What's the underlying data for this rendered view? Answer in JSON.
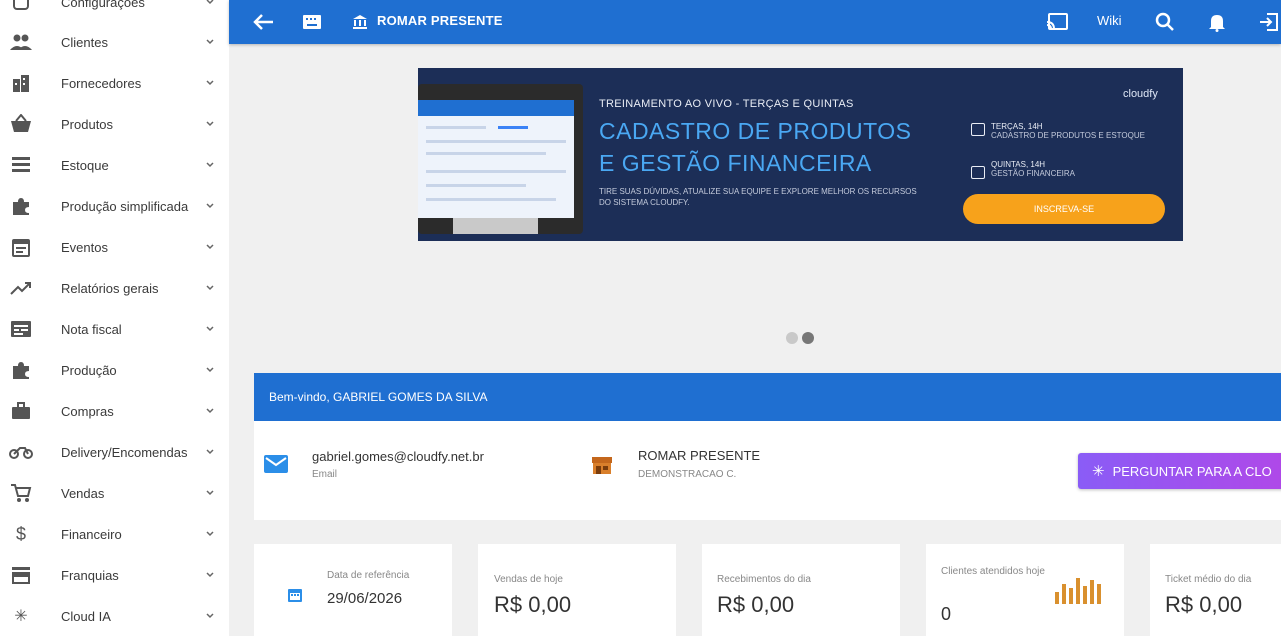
{
  "sidebar": {
    "items": [
      {
        "label": "Configurações",
        "icon": "gear-icon"
      },
      {
        "label": "Clientes",
        "icon": "people-icon"
      },
      {
        "label": "Fornecedores",
        "icon": "building-icon"
      },
      {
        "label": "Produtos",
        "icon": "basket-icon"
      },
      {
        "label": "Estoque",
        "icon": "list-icon"
      },
      {
        "label": "Produção simplificada",
        "icon": "puzzle-icon"
      },
      {
        "label": "Eventos",
        "icon": "calendar-icon"
      },
      {
        "label": "Relatórios gerais",
        "icon": "trending-icon"
      },
      {
        "label": "Nota fiscal",
        "icon": "receipt-icon"
      },
      {
        "label": "Produção",
        "icon": "puzzle-icon"
      },
      {
        "label": "Compras",
        "icon": "briefcase-icon"
      },
      {
        "label": "Delivery/Encomendas",
        "icon": "bike-icon"
      },
      {
        "label": "Vendas",
        "icon": "cart-icon"
      },
      {
        "label": "Financeiro",
        "icon": "dollar-icon"
      },
      {
        "label": "Franquias",
        "icon": "store-icon"
      },
      {
        "label": "Cloud IA",
        "icon": "sparkle-icon"
      }
    ]
  },
  "topbar": {
    "store_name": "ROMAR PRESENTE",
    "wiki_label": "Wiki"
  },
  "banner": {
    "small_title": "TREINAMENTO AO VIVO - TERÇAS E QUINTAS",
    "big_line1": "CADASTRO DE PRODUTOS",
    "big_line2": "E GESTÃO FINANCEIRA",
    "description": "TIRE SUAS DÚVIDAS, ATUALIZE SUA EQUIPE E EXPLORE MELHOR OS RECURSOS DO SISTEMA CLOUDFY.",
    "logo": "cloudfy",
    "schedule1_day": "TERÇAS, 14H",
    "schedule1_topic": "CADASTRO DE PRODUTOS E ESTOQUE",
    "schedule2_day": "QUINTAS, 14H",
    "schedule2_topic": "GESTÃO FINANCEIRA",
    "cta": "INSCREVA-SE"
  },
  "welcome": {
    "greeting": "Bem-vindo, GABRIEL GOMES DA SILVA",
    "email": "gabriel.gomes@cloudfy.net.br",
    "email_label": "Email",
    "store": "ROMAR PRESENTE",
    "store_sub": "DEMONSTRACAO C.",
    "ask_button": "PERGUNTAR PARA A CLO"
  },
  "stats": [
    {
      "label": "Data de referência",
      "value": "29/06/2026"
    },
    {
      "label": "Vendas de hoje",
      "value": "R$ 0,00"
    },
    {
      "label": "Recebimentos do dia",
      "value": "R$ 0,00"
    },
    {
      "label": "Clientes atendidos hoje",
      "value": "0"
    },
    {
      "label": "Ticket médio do dia",
      "value": "R$ 0,00"
    }
  ],
  "colors": {
    "primary": "#1f6fd1",
    "banner_bg": "#1c2e57",
    "banner_accent": "#4aa8f3",
    "cta": "#f7a21b",
    "ask_gradient_start": "#8a5cf6",
    "ask_gradient_end": "#b048e8"
  }
}
